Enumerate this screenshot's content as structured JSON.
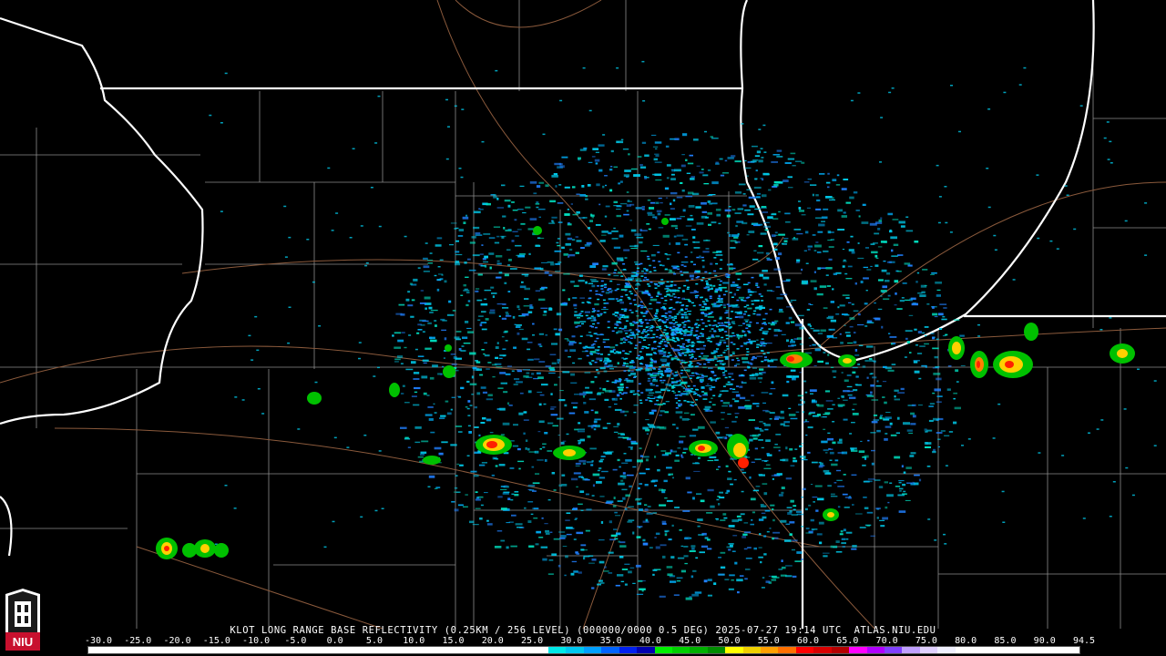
{
  "caption": "KLOT LONG RANGE BASE REFLECTIVITY (0.25KM / 256 LEVEL) (000000/0000 0.5 DEG) 2025-07-27 19:14 UTC  ATLAS.NIU.EDU",
  "scale": {
    "labels": [
      "-30.0",
      "-25.0",
      "-20.0",
      "-15.0",
      "-10.0",
      "-5.0",
      "0.0",
      "5.0",
      "10.0",
      "15.0",
      "20.0",
      "25.0",
      "30.0",
      "35.0",
      "40.0",
      "45.0",
      "50.0",
      "55.0",
      "60.0",
      "65.0",
      "70.0",
      "75.0",
      "80.0",
      "85.0",
      "90.0",
      "94.5"
    ],
    "colors": [
      "#ffffff",
      "#ffffff",
      "#ffffff",
      "#ffffff",
      "#ffffff",
      "#ffffff",
      "#ffffff",
      "#ffffff",
      "#ffffff",
      "#ffffff",
      "#ffffff",
      "#ffffff",
      "#ffffff",
      "#ffffff",
      "#ffffff",
      "#ffffff",
      "#ffffff",
      "#ffffff",
      "#ffffff",
      "#ffffff",
      "#ffffff",
      "#ffffff",
      "#ffffff",
      "#ffffff",
      "#ffffff",
      "#ffffff",
      "#00e8e8",
      "#00c8f0",
      "#00a0ff",
      "#0064ff",
      "#0020f0",
      "#0000b0",
      "#00f000",
      "#00d000",
      "#00b000",
      "#008c00",
      "#ffff00",
      "#f0d000",
      "#ffa000",
      "#ff7000",
      "#ff0000",
      "#d80000",
      "#b40000",
      "#ff00ff",
      "#b000ff",
      "#8040ff",
      "#c0a0ff",
      "#e0d0ff",
      "#f0f0ff",
      "#ffffff",
      "#ffffff",
      "#ffffff",
      "#ffffff",
      "#ffffff",
      "#ffffff",
      "#ffffff"
    ]
  },
  "logo": {
    "text": "NIU",
    "color": "#c8102e"
  },
  "colors": {
    "state_border": "#ffffff",
    "county_line": "#9a9a9a",
    "road": "#8b5a3c",
    "radar_light": "#00c8e8",
    "radar_mid": "#2080ff",
    "storm_core": "#ff2000"
  }
}
